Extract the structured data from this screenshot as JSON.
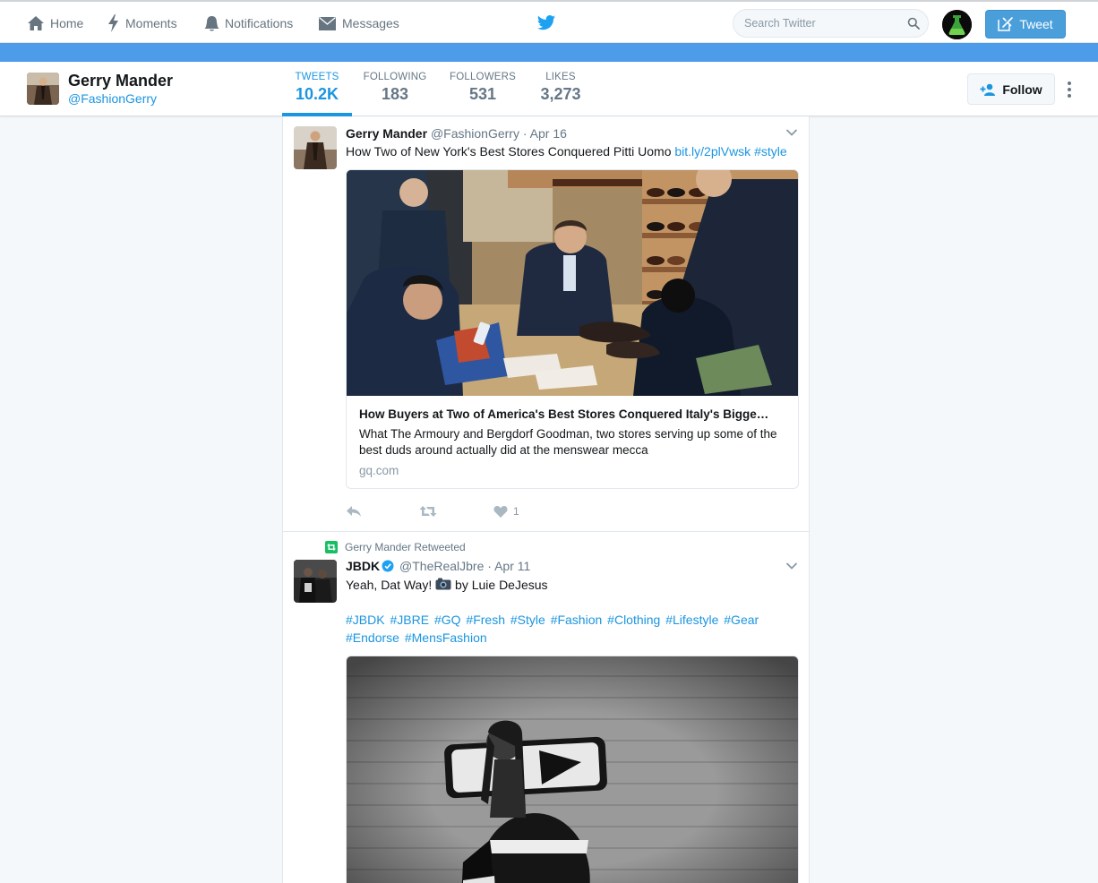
{
  "topnav": {
    "items": [
      {
        "label": "Home",
        "icon": "home-icon"
      },
      {
        "label": "Moments",
        "icon": "lightning-icon"
      },
      {
        "label": "Notifications",
        "icon": "bell-icon"
      },
      {
        "label": "Messages",
        "icon": "envelope-icon"
      }
    ],
    "search_placeholder": "Search Twitter",
    "tweet_button": "Tweet"
  },
  "profile": {
    "name": "Gerry Mander",
    "handle": "@FashionGerry",
    "stats": [
      {
        "label": "TWEETS",
        "value": "10.2K",
        "active": true
      },
      {
        "label": "FOLLOWING",
        "value": "183"
      },
      {
        "label": "FOLLOWERS",
        "value": "531"
      },
      {
        "label": "LIKES",
        "value": "3,273"
      }
    ],
    "follow_button": "Follow"
  },
  "tweets": [
    {
      "name": "Gerry Mander",
      "handle": "@FashionGerry",
      "separator": "·",
      "time": "Apr 16",
      "text": "How Two of New York's Best Stores Conquered Pitti Uomo",
      "link": "bit.ly/2plVwsk",
      "hashtag": "#style",
      "card": {
        "title": "How Buyers at Two of America's Best Stores Conquered Italy's Bigge…",
        "description": "What The Armoury and Bergdorf Goodman, two stores serving up some of the best duds around actually did at the menswear mecca",
        "domain": "gq.com"
      },
      "like_count": "1"
    },
    {
      "retweet_context": "Gerry Mander Retweeted",
      "name": "JBDK",
      "handle": "@TheRealJbre",
      "separator": "·",
      "time": "Apr 11",
      "text_before": "Yeah, Dat Way!",
      "text_after": "by Luie DeJesus",
      "hashtags": [
        "#JBDK",
        "#JBRE",
        "#GQ",
        "#Fresh",
        "#Style",
        "#Fashion",
        "#Clothing",
        "#Lifestyle",
        "#Gear",
        "#Endorse",
        "#MensFashion"
      ]
    }
  ],
  "colors": {
    "accent": "#1b95e0",
    "banner": "#4d9cea",
    "retweet_green": "#17bf63"
  }
}
